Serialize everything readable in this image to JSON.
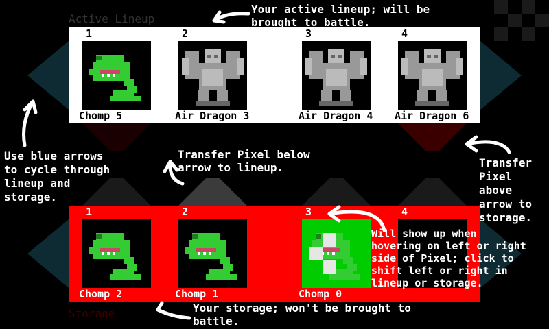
{
  "active": {
    "title": "Active Lineup",
    "slots": [
      {
        "num": "1",
        "name": "Chomp 5",
        "creature": "plant-icon",
        "highlight": false
      },
      {
        "num": "2",
        "name": "Air Dragon 3",
        "creature": "gargoyle-icon",
        "highlight": false
      },
      {
        "num": "3",
        "name": "Air Dragon 4",
        "creature": "gargoyle-icon",
        "highlight": false
      },
      {
        "num": "4",
        "name": "Air Dragon 6",
        "creature": "gargoyle-icon",
        "highlight": false
      }
    ]
  },
  "storage": {
    "title": "Storage",
    "slots": [
      {
        "num": "1",
        "name": "Chomp 2",
        "creature": "plant-icon",
        "highlight": false
      },
      {
        "num": "2",
        "name": "Chomp 1",
        "creature": "plant-icon",
        "highlight": false
      },
      {
        "num": "3",
        "name": "Chomp 0",
        "creature": "plant-icon",
        "highlight": true
      },
      {
        "num": "4",
        "name": "",
        "creature": "",
        "highlight": false
      }
    ]
  },
  "notes": {
    "active_lineup": "Your active lineup; will be\nbrought to battle.",
    "blue_arrows": "Use blue arrows\nto cycle through\nlineup and\nstorage.",
    "transfer_below": "Transfer Pixel below\narrow to lineup.",
    "transfer_above": "Transfer\nPixel\nabove\narrow to\nstorage.",
    "hover": "Will show up when\nhovering on left or right\nside of Pixel; click to\nshift left or right in\nlineup or storage.",
    "storage_note": "Your storage; won't be brought to\nbattle."
  },
  "colors": {
    "active_bg": "#ffffff",
    "storage_bg": "#ff0000",
    "plant_green": "#33cc33",
    "gargoyle_gray": "#999999",
    "highlight_green": "#00cc00"
  }
}
